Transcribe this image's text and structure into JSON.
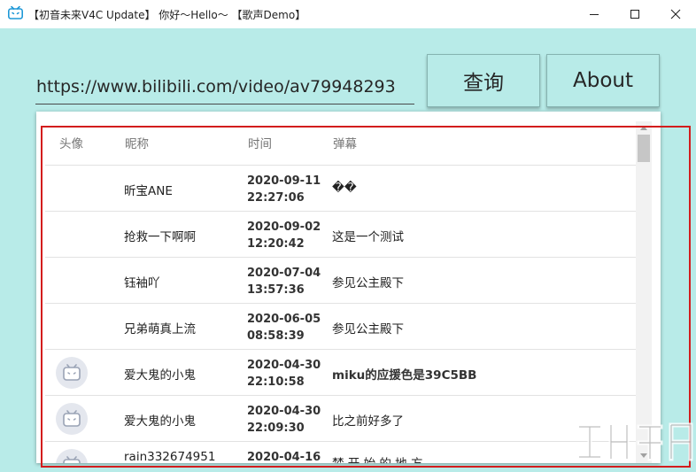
{
  "window": {
    "title": "【初音未来V4C Update】 你好～Hello～ 【歌声Demo】",
    "icon": "bilibili-tv-icon",
    "controls": [
      "minimize-icon",
      "maximize-icon",
      "close-icon"
    ]
  },
  "search": {
    "value": "https://www.bilibili.com/video/av79948293",
    "query_label": "查询",
    "about_label": "About"
  },
  "table": {
    "headers": [
      "头像",
      "昵称",
      "时间",
      "弹幕"
    ],
    "rows": [
      {
        "avatar": false,
        "name": "昕宝ANE",
        "date": "2020-09-11",
        "time": "22:27:06",
        "message": "��",
        "message_bold": false
      },
      {
        "avatar": false,
        "name": "抢救一下啊啊",
        "date": "2020-09-02",
        "time": "12:20:42",
        "message": "这是一个测试",
        "message_bold": false
      },
      {
        "avatar": false,
        "name": "钰袖吖",
        "date": "2020-07-04",
        "time": "13:57:36",
        "message": "参见公主殿下",
        "message_bold": false
      },
      {
        "avatar": false,
        "name": "兄弟萌真上流",
        "date": "2020-06-05",
        "time": "08:58:39",
        "message": "参见公主殿下",
        "message_bold": false
      },
      {
        "avatar": true,
        "name": "爱大鬼的小鬼",
        "date": "2020-04-30",
        "time": "22:10:58",
        "message": "miku的应援色是39C5BB",
        "message_bold": true
      },
      {
        "avatar": true,
        "name": "爱大鬼的小鬼",
        "date": "2020-04-30",
        "time": "22:09:30",
        "message": "比之前好多了",
        "message_bold": false
      },
      {
        "avatar": true,
        "name": "rain332674951",
        "date": "2020-04-16",
        "time": "",
        "message": "梦 开 始 的 地 方",
        "message_bold": false
      }
    ]
  },
  "colors": {
    "background": "#b8ebe8",
    "highlight_border": "#d31d1d",
    "icon_blue": "#1e98d7"
  },
  "watermark": {
    "icon": "download-site-watermark-icon"
  }
}
